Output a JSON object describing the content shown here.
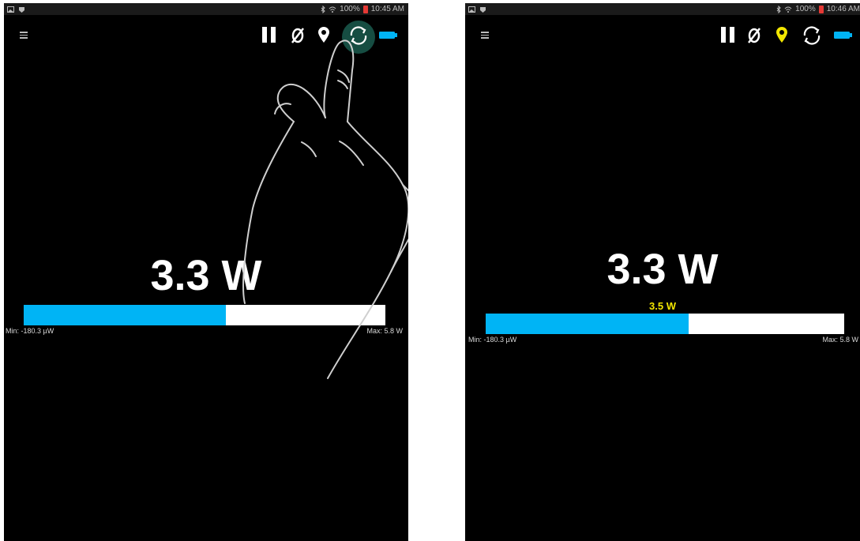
{
  "left": {
    "status": {
      "time": "10:45 AM",
      "battery": "100%"
    },
    "reading": "3.3 W",
    "progress": 0.56,
    "min_label": "Min: -180.3 µW",
    "max_label": "Max: 5.8 W",
    "location_active": false,
    "touch_highlight": "refresh-button"
  },
  "right": {
    "status": {
      "time": "10:46 AM",
      "battery": "100%"
    },
    "reading": "3.3 W",
    "marker_label": "3.5 W",
    "progress": 0.565,
    "min_label": "Min: -180.3 µW",
    "max_label": "Max: 5.8 W",
    "location_active": true
  },
  "toolbar_icons": [
    "menu-icon",
    "pause-icon",
    "zero-icon",
    "location-icon",
    "refresh-icon",
    "battery-icon"
  ],
  "colors": {
    "bar_fill": "#00b4f5",
    "bar_track": "#ffffff",
    "marker": "#f2e600",
    "background": "#000000"
  }
}
